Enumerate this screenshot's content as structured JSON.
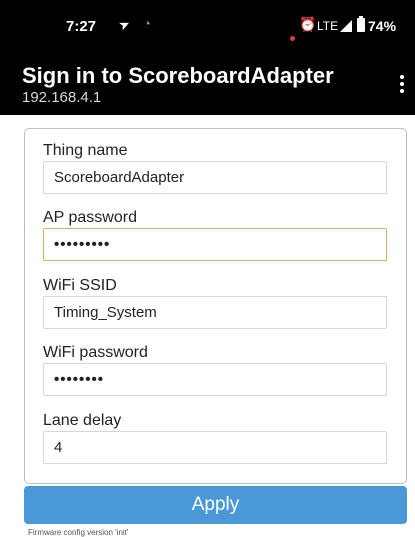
{
  "status_bar": {
    "time": "7:27",
    "network": "LTE",
    "battery": "74%"
  },
  "header": {
    "title": "Sign in to ScoreboardAdapter",
    "subtitle": "192.168.4.1"
  },
  "form": {
    "fields": [
      {
        "label": "Thing name",
        "value": "ScoreboardAdapter"
      },
      {
        "label": "AP password",
        "value": "•••••••••"
      },
      {
        "label": "WiFi SSID",
        "value": "Timing_System"
      },
      {
        "label": "WiFi password",
        "value": "••••••••"
      },
      {
        "label": "Lane delay",
        "value": "4"
      }
    ]
  },
  "apply_label": "Apply",
  "footer": "Firmware config version 'init'",
  "colors": {
    "accent": "#4a98d6",
    "focus": "#d9b060"
  }
}
